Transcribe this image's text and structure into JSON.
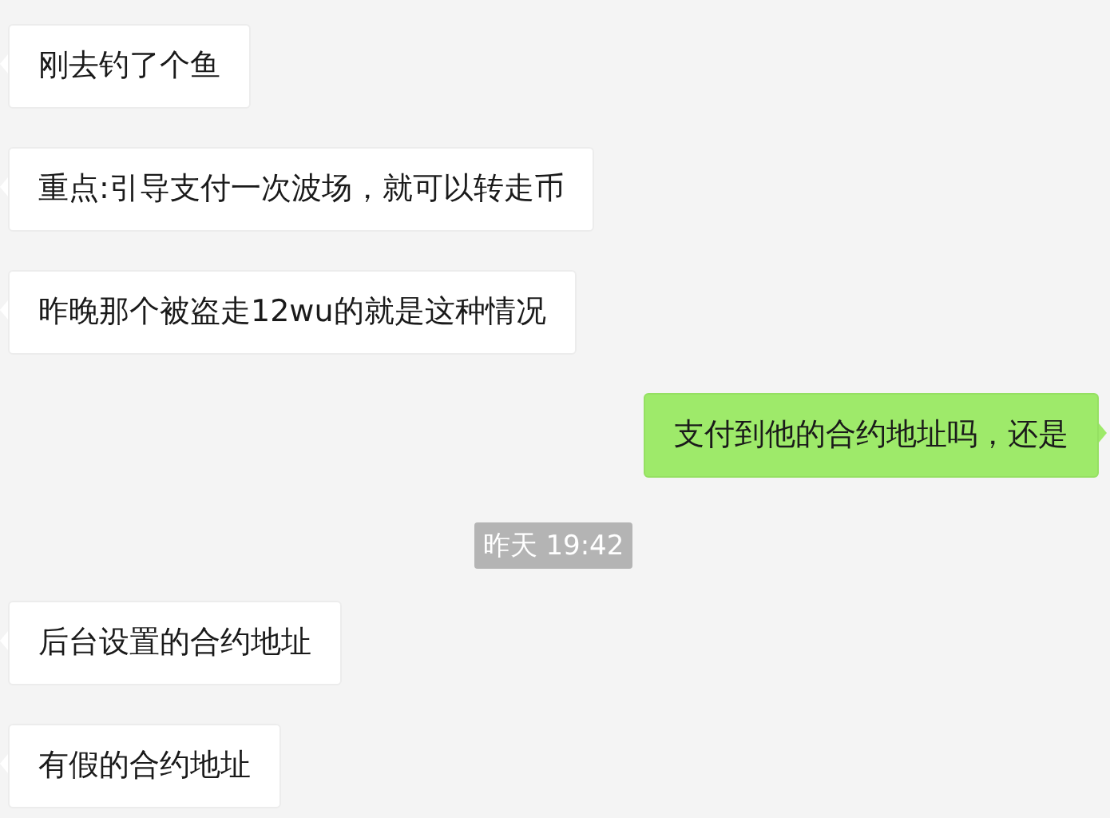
{
  "messages": [
    {
      "kind": "incoming",
      "text": "刚去钓了个鱼"
    },
    {
      "kind": "incoming",
      "text": "重点:引导支付一次波场，就可以转走币"
    },
    {
      "kind": "incoming",
      "text": "昨晚那个被盗走12wu的就是这种情况"
    },
    {
      "kind": "outgoing",
      "text": "支付到他的合约地址吗，还是"
    },
    {
      "kind": "time",
      "text": "昨天 19:42"
    },
    {
      "kind": "incoming",
      "text": "后台设置的合约地址"
    },
    {
      "kind": "incoming",
      "text": "有假的合约地址"
    }
  ]
}
